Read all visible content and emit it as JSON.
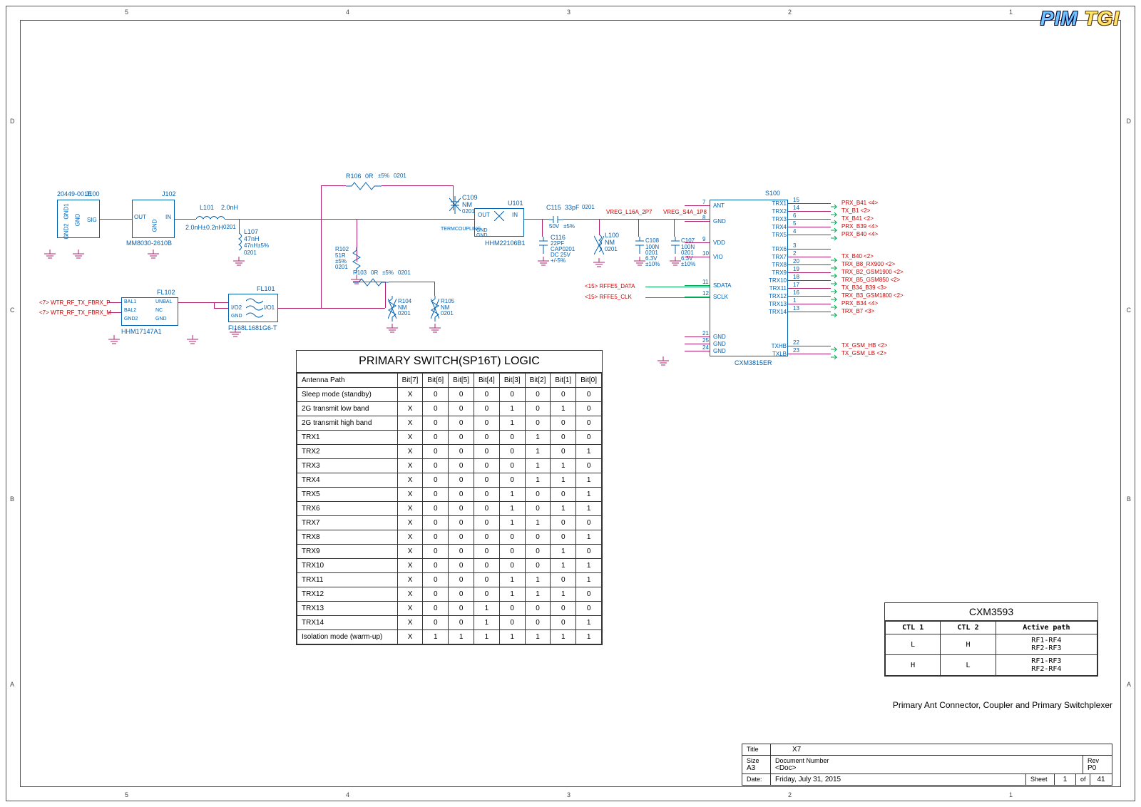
{
  "watermark": {
    "a": "PIM",
    "b": "TGI"
  },
  "border": {
    "top_numbers": [
      "5",
      "4",
      "3",
      "2",
      "1"
    ],
    "side_letters": [
      "D",
      "C",
      "B",
      "A"
    ]
  },
  "title_block": {
    "heading": "Primary Ant Connector, Coupler and Primary Switchplexer",
    "title_label": "Title",
    "title_value": "X7",
    "size_label": "Size",
    "size_value": "A3",
    "doc_label": "Document Number",
    "doc_value": "<Doc>",
    "rev_label": "Rev",
    "rev_value": "P0",
    "date_label": "Date:",
    "date_value": "Friday, July 31, 2015",
    "sheet_label": "Sheet",
    "sheet_cur": "1",
    "sheet_of": "of",
    "sheet_total": "41"
  },
  "logic_table": {
    "title": "PRIMARY SWITCH(SP16T) LOGIC",
    "header": [
      "Antenna Path",
      "Bit[7]",
      "Bit[6]",
      "Bit[5]",
      "Bit[4]",
      "Bit[3]",
      "Bit[2]",
      "Bit[1]",
      "Bit[0]"
    ],
    "rows": [
      [
        "Sleep mode (standby)",
        "X",
        "0",
        "0",
        "0",
        "0",
        "0",
        "0",
        "0"
      ],
      [
        "2G transmit low band",
        "X",
        "0",
        "0",
        "0",
        "1",
        "0",
        "1",
        "0"
      ],
      [
        "2G transmit high band",
        "X",
        "0",
        "0",
        "0",
        "1",
        "0",
        "0",
        "0"
      ],
      [
        "TRX1",
        "X",
        "0",
        "0",
        "0",
        "0",
        "1",
        "0",
        "0"
      ],
      [
        "TRX2",
        "X",
        "0",
        "0",
        "0",
        "0",
        "1",
        "0",
        "1"
      ],
      [
        "TRX3",
        "X",
        "0",
        "0",
        "0",
        "0",
        "1",
        "1",
        "0"
      ],
      [
        "TRX4",
        "X",
        "0",
        "0",
        "0",
        "0",
        "1",
        "1",
        "1"
      ],
      [
        "TRX5",
        "X",
        "0",
        "0",
        "0",
        "1",
        "0",
        "0",
        "1"
      ],
      [
        "TRX6",
        "X",
        "0",
        "0",
        "0",
        "1",
        "0",
        "1",
        "1"
      ],
      [
        "TRX7",
        "X",
        "0",
        "0",
        "0",
        "1",
        "1",
        "0",
        "0"
      ],
      [
        "TRX8",
        "X",
        "0",
        "0",
        "0",
        "0",
        "0",
        "0",
        "1"
      ],
      [
        "TRX9",
        "X",
        "0",
        "0",
        "0",
        "0",
        "0",
        "1",
        "0"
      ],
      [
        "TRX10",
        "X",
        "0",
        "0",
        "0",
        "0",
        "0",
        "1",
        "1"
      ],
      [
        "TRX11",
        "X",
        "0",
        "0",
        "0",
        "1",
        "1",
        "0",
        "1"
      ],
      [
        "TRX12",
        "X",
        "0",
        "0",
        "0",
        "1",
        "1",
        "1",
        "0"
      ],
      [
        "TRX13",
        "X",
        "0",
        "0",
        "1",
        "0",
        "0",
        "0",
        "0"
      ],
      [
        "TRX14",
        "X",
        "0",
        "0",
        "1",
        "0",
        "0",
        "0",
        "1"
      ],
      [
        "Isolation mode (warm-up)",
        "X",
        "1",
        "1",
        "1",
        "1",
        "1",
        "1",
        "1"
      ]
    ]
  },
  "ctl_table": {
    "title": "CXM3593",
    "header": [
      "CTL 1",
      "CTL 2",
      "Active path"
    ],
    "rows": [
      [
        "L",
        "H",
        "RF1-RF4\nRF2-RF3"
      ],
      [
        "H",
        "L",
        "RF1-RF3\nRF2-RF4"
      ]
    ]
  },
  "components": {
    "J100": {
      "ref": "J100",
      "value": "20449-001E",
      "pins": {
        "1": "SIG",
        "2": "GND",
        "3": "",
        "4": "GND1",
        "5": "GND2"
      }
    },
    "J102": {
      "ref": "J102",
      "value": "MM8030-2610B",
      "pins": {
        "1": "OUT",
        "2": "GND",
        "3": "IN"
      }
    },
    "L101": {
      "ref": "L101",
      "value": "2.0nH±0.2nH",
      "pkg": "0201",
      "ind": "2.0nH"
    },
    "L107": {
      "ref": "L107",
      "value": "47nH",
      "tol": "47nH±5%",
      "pkg": "0201"
    },
    "R106": {
      "ref": "R106",
      "value": "0R",
      "tol": "±5%",
      "pkg": "0201"
    },
    "R102": {
      "ref": "R102",
      "value": "51R",
      "tol": "±5%",
      "pkg": "0201"
    },
    "R103": {
      "ref": "R103",
      "value": "0R",
      "tol": "±5%",
      "pkg": "0201"
    },
    "R104": {
      "ref": "R104",
      "value": "NM",
      "pkg": "0201"
    },
    "R105": {
      "ref": "R105",
      "value": "NM",
      "pkg": "0201"
    },
    "C109": {
      "ref": "C109",
      "value": "NM",
      "pkg": "0201"
    },
    "C115": {
      "ref": "C115",
      "value": "33pF",
      "pkg": "0201",
      "volt": "50V",
      "tol": "±5%"
    },
    "C116": {
      "ref": "C116",
      "value": "22PF",
      "pkg": "CAP0201",
      "volt": "DC 25V",
      "tol": "+/-5%"
    },
    "C107": {
      "ref": "C107",
      "value": "100N",
      "pkg": "0201",
      "volt": "6.3V",
      "tol": "±10%"
    },
    "C108": {
      "ref": "C108",
      "value": "100N",
      "pkg": "0201",
      "volt": "6.3V",
      "tol": "±10%"
    },
    "L100": {
      "ref": "L100",
      "value": "NM",
      "pkg": "0201"
    },
    "U101": {
      "ref": "U101",
      "value": "HHM22106B1",
      "pins": {
        "1": "OUT",
        "2": "IN",
        "3": "GND",
        "4": "",
        "5": "GND",
        "6": "TERMCOUPLING"
      }
    },
    "FL101": {
      "ref": "FL101",
      "value": "FI168L1681G6-T",
      "pins": {
        "1": "I/O1",
        "2": "I/O2",
        "3": "GND"
      }
    },
    "FL102": {
      "ref": "FL102",
      "value": "HHM17147A1",
      "pins": {
        "1": "UNBAL",
        "2": "GND",
        "3": "BAL1",
        "4": "BAL2",
        "5": "GND2",
        "6": "NC"
      }
    },
    "S100": {
      "ref": "S100",
      "value": "CXM3815ER",
      "pins_left": [
        {
          "n": "7",
          "name": "ANT"
        },
        {
          "n": "8",
          "name": "GND"
        },
        {
          "n": "9",
          "name": "VDD"
        },
        {
          "n": "10",
          "name": "VIO"
        },
        {
          "n": "11",
          "name": "SDATA"
        },
        {
          "n": "12",
          "name": "SCLK"
        },
        {
          "n": "21",
          "name": "GND"
        },
        {
          "n": "25",
          "name": "GND"
        },
        {
          "n": "24",
          "name": "GND"
        }
      ],
      "pins_right": [
        {
          "n": "15",
          "name": "TRX1"
        },
        {
          "n": "14",
          "name": "TRX2"
        },
        {
          "n": "6",
          "name": "TRX3"
        },
        {
          "n": "5",
          "name": "TRX4"
        },
        {
          "n": "4",
          "name": "TRX5"
        },
        {
          "n": "3",
          "name": "TRX6"
        },
        {
          "n": "2",
          "name": "TRX7"
        },
        {
          "n": "20",
          "name": "TRX8"
        },
        {
          "n": "19",
          "name": "TRX9"
        },
        {
          "n": "18",
          "name": "TRX10"
        },
        {
          "n": "17",
          "name": "TRX11"
        },
        {
          "n": "16",
          "name": "TRX12"
        },
        {
          "n": "1",
          "name": "TRX13"
        },
        {
          "n": "13",
          "name": "TRX14"
        },
        {
          "n": "22",
          "name": "TXHB"
        },
        {
          "n": "23",
          "name": "TXLB"
        }
      ]
    }
  },
  "nets": {
    "vreg1": "VREG_L16A_2P7",
    "vreg2": "VREG_S4A_1P8",
    "rffe_data": "<15> RFFE5_DATA",
    "rffe_clk": "<15> RFFE5_CLK",
    "fbrx_p": "<7> WTR_RF_TX_FBRX_P",
    "fbrx_m": "<7> WTR_RF_TX_FBRX_M"
  },
  "trx_nets": [
    "PRX_B41 <4>",
    "TX_B1 <2>",
    "TX_B41 <2>",
    "PRX_B39 <4>",
    "PRX_B40 <4>",
    "",
    "TX_B40 <2>",
    "TRX_B8_RX900 <2>",
    "TRX_B2_GSM1900 <2>",
    "TRX_B5_GSM850 <2>",
    "TX_B34_B39  <3>",
    "TRX_B3_GSM1800 <2>",
    "PRX_B34 <4>",
    "TRX_B7 <3>",
    "TX_GSM_HB <2>",
    "TX_GSM_LB <2>"
  ]
}
